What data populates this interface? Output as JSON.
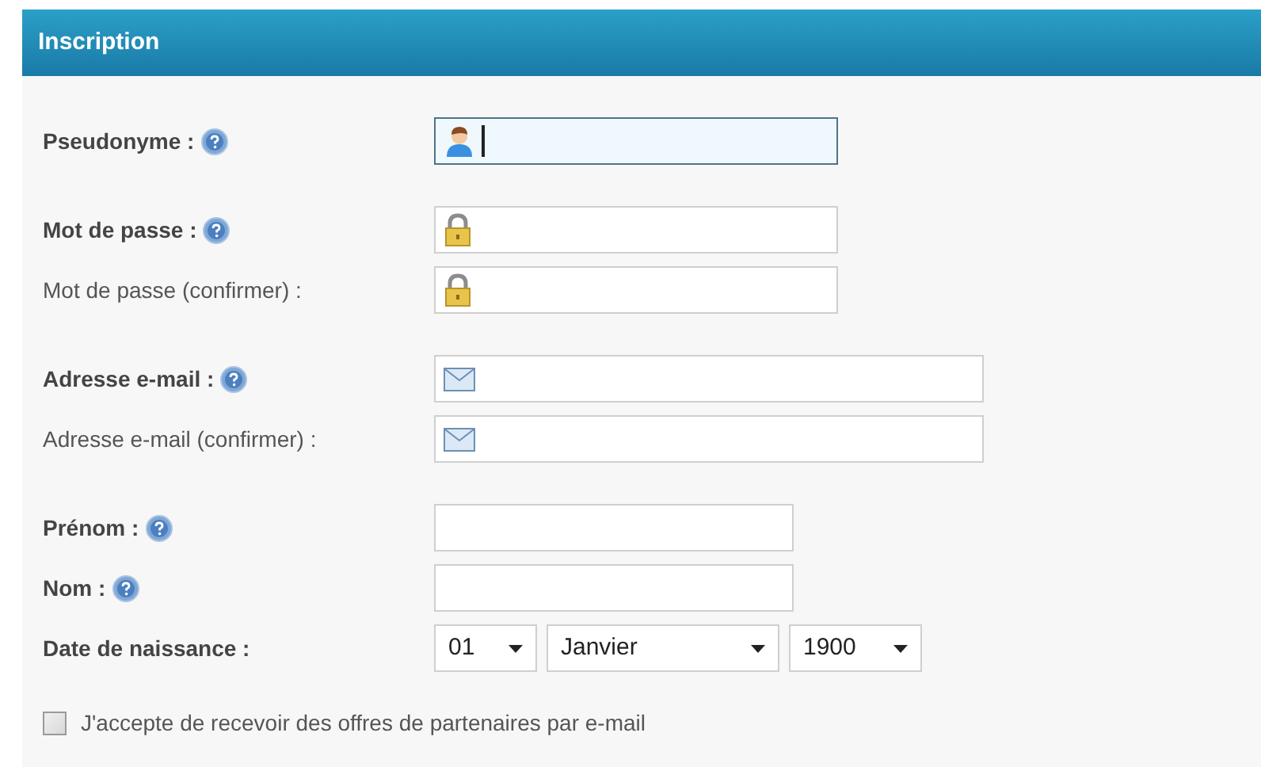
{
  "header": {
    "title": "Inscription"
  },
  "groups": [
    {
      "fields": [
        {
          "label": "Pseudonyme :",
          "kind": "username",
          "help": true,
          "focused": true
        }
      ]
    },
    {
      "fields": [
        {
          "label": "Mot de passe :",
          "kind": "password",
          "help": true,
          "focused": false
        },
        {
          "label": "Mot de passe (confirmer) :",
          "kind": "password-confirm",
          "help": false,
          "focused": false
        }
      ]
    },
    {
      "fields": [
        {
          "label": "Adresse e-mail :",
          "kind": "email",
          "help": true,
          "focused": false
        },
        {
          "label": "Adresse e-mail (confirmer) :",
          "kind": "email-confirm",
          "help": false,
          "focused": false
        }
      ]
    },
    {
      "fields": [
        {
          "label": "Prénom :",
          "kind": "name",
          "help": true,
          "focused": false
        },
        {
          "label": "Nom :",
          "kind": "name",
          "help": true,
          "focused": false
        }
      ],
      "date": {
        "label": "Date de naissance :",
        "selects": [
          {
            "value": "01"
          },
          {
            "value": "Janvier"
          },
          {
            "value": "1900"
          }
        ]
      }
    }
  ],
  "newsletter": {
    "label": "J'accepte de recevoir des offres de partenaires par e-mail",
    "checked": false
  }
}
